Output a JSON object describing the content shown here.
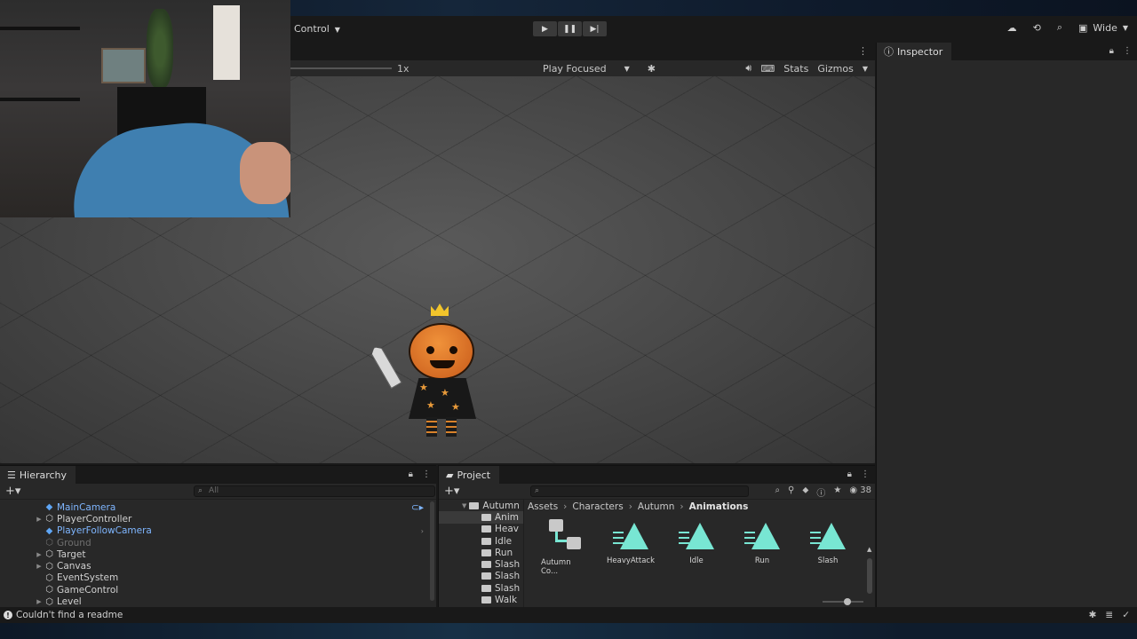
{
  "toolbar": {
    "control_label": "Control",
    "layout_label": "Wide"
  },
  "scene": {
    "speed_label": "1x",
    "play_focused_label": "Play Focused",
    "stats_label": "Stats",
    "gizmos_label": "Gizmos"
  },
  "inspector": {
    "tab_label": "Inspector"
  },
  "hierarchy": {
    "tab_label": "Hierarchy",
    "search_placeholder": "All",
    "items": [
      {
        "label": "MainCamera"
      },
      {
        "label": "PlayerController"
      },
      {
        "label": "PlayerFollowCamera"
      },
      {
        "label": "Ground"
      },
      {
        "label": "Target"
      },
      {
        "label": "Canvas"
      },
      {
        "label": "EventSystem"
      },
      {
        "label": "GameControl"
      },
      {
        "label": "Level"
      }
    ]
  },
  "project": {
    "tab_label": "Project",
    "item_count": "38",
    "folders": [
      {
        "label": "Autumn"
      },
      {
        "label": "Anim"
      },
      {
        "label": "Heav"
      },
      {
        "label": "Idle"
      },
      {
        "label": "Run"
      },
      {
        "label": "Slash"
      },
      {
        "label": "Slash"
      },
      {
        "label": "Slash"
      },
      {
        "label": "Walk"
      }
    ],
    "breadcrumb": [
      "Assets",
      "Characters",
      "Autumn",
      "Animations"
    ],
    "assets": [
      {
        "label": "Autumn Co..."
      },
      {
        "label": "HeavyAttack"
      },
      {
        "label": "Idle"
      },
      {
        "label": "Run"
      },
      {
        "label": "Slash"
      }
    ]
  },
  "status": {
    "message": "Couldn't find a readme"
  },
  "colors": {
    "accent_blue": "#7fb6ff",
    "animation_teal": "#78e6d3",
    "pumpkin_orange": "#e8862f"
  }
}
